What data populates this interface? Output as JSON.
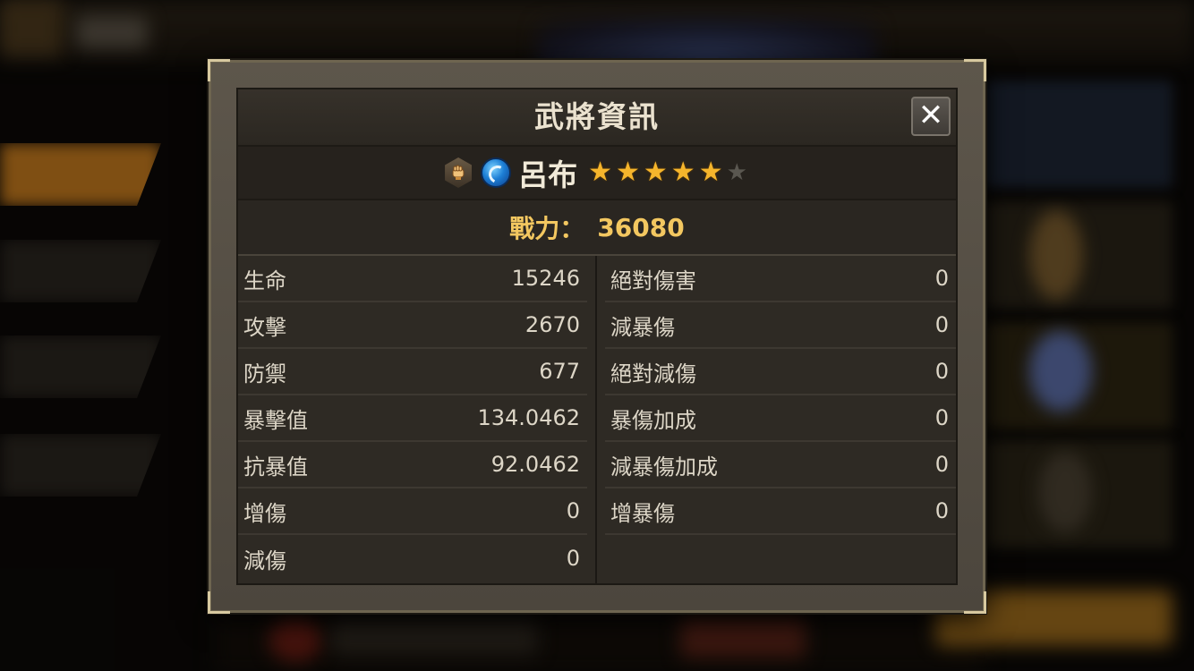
{
  "dialog": {
    "title": "武將資訊",
    "close_symbol": "✕"
  },
  "hero": {
    "type_icon": "fist-icon",
    "element_icon": "water-icon",
    "name": "呂布",
    "stars_filled": 5,
    "stars_total": 6
  },
  "power": {
    "label": "戰力：",
    "value": "36080"
  },
  "stats_left": [
    {
      "name": "生命",
      "value": "15246"
    },
    {
      "name": "攻擊",
      "value": "2670"
    },
    {
      "name": "防禦",
      "value": "677"
    },
    {
      "name": "暴擊值",
      "value": "134.0462"
    },
    {
      "name": "抗暴值",
      "value": "92.0462"
    },
    {
      "name": "增傷",
      "value": "0"
    },
    {
      "name": "減傷",
      "value": "0"
    }
  ],
  "stats_right": [
    {
      "name": "絕對傷害",
      "value": "0"
    },
    {
      "name": "減暴傷",
      "value": "0"
    },
    {
      "name": "絕對減傷",
      "value": "0"
    },
    {
      "name": "暴傷加成",
      "value": "0"
    },
    {
      "name": "減暴傷加成",
      "value": "0"
    },
    {
      "name": "增暴傷",
      "value": "0"
    }
  ],
  "colors": {
    "power_text": "#f3c760",
    "star_on": "#f5b52c",
    "star_off": "#5a5750"
  }
}
